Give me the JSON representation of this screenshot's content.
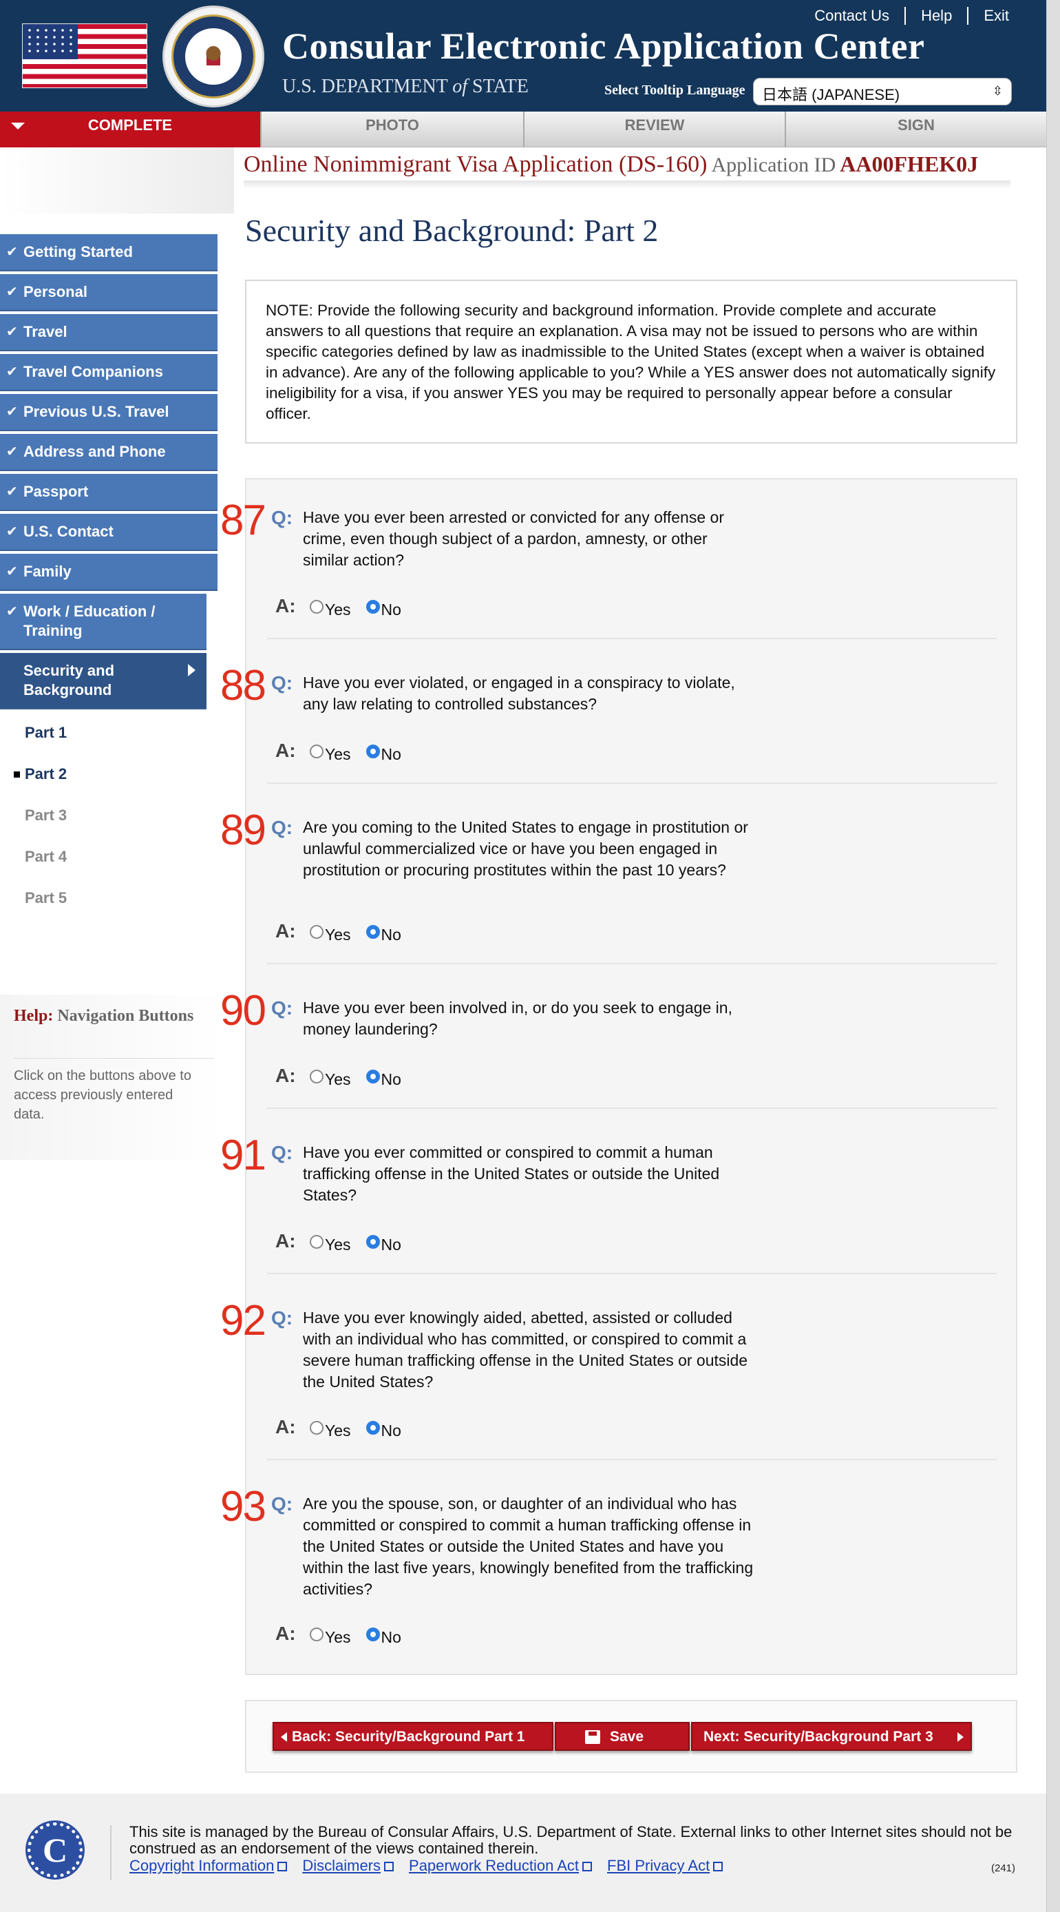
{
  "header": {
    "title": "Consular Electronic Application Center",
    "dept_prefix": "U.S. DEPARTMENT ",
    "dept_of": "of",
    "dept_suffix": " STATE",
    "links": [
      "Contact Us",
      "Help",
      "Exit"
    ],
    "tooltip_label": "Select Tooltip Language",
    "tooltip_value": "日本語 (JAPANESE)"
  },
  "progress": {
    "tabs": [
      "COMPLETE",
      "PHOTO",
      "REVIEW",
      "SIGN"
    ],
    "active": "COMPLETE"
  },
  "app": {
    "form_title": "Online Nonimmigrant Visa Application (DS-160)",
    "id_label": "Application ID",
    "id_value": "AA00FHEK0J"
  },
  "sidebar": {
    "items": [
      "Getting Started",
      "Personal",
      "Travel",
      "Travel Companions",
      "Previous U.S. Travel",
      "Address and Phone",
      "Passport",
      "U.S. Contact",
      "Family",
      "Work / Education / Training"
    ],
    "current": "Security and Background",
    "sub_items": [
      "Part 1",
      "Part 2",
      "Part 3",
      "Part 4",
      "Part 5"
    ]
  },
  "help": {
    "title_red": "Help:",
    "title_rest": " Navigation Buttons",
    "text": "Click on the buttons above to access previously entered data."
  },
  "main": {
    "page_title": "Security and Background: Part 2",
    "note": "NOTE: Provide the following security and background information. Provide complete and accurate answers to all questions that require an explanation. A visa may not be issued to persons who are within specific categories defined by law as inadmissible to the United States (except when a waiver is obtained in advance). Are any of the following applicable to you? While a YES answer does not automatically signify ineligibility for a visa, if you answer YES you may be required to personally appear before a consular officer.",
    "q_label": "Q:",
    "a_label": "A:",
    "yes_label": "Yes",
    "no_label": "No",
    "questions": [
      {
        "num": "87",
        "text": "Have you ever been arrested or convicted for any offense or crime, even though subject of a pardon, amnesty, or other similar action?",
        "answer": "No"
      },
      {
        "num": "88",
        "text": "Have you ever violated, or engaged in a conspiracy to violate, any law relating to controlled substances?",
        "answer": "No"
      },
      {
        "num": "89",
        "text": "Are you coming to the United States to engage in prostitution or unlawful commercialized vice or have you been engaged in prostitution or procuring prostitutes within the past 10 years?",
        "answer": "No"
      },
      {
        "num": "90",
        "text": "Have you ever been involved in, or do you seek to engage in, money laundering?",
        "answer": "No"
      },
      {
        "num": "91",
        "text": "Have you ever committed or conspired to commit a human trafficking offense in the United States or outside the United States?",
        "answer": "No"
      },
      {
        "num": "92",
        "text": "Have you ever knowingly aided, abetted, assisted or colluded with an individual who has committed, or conspired to commit a severe human trafficking offense in the United States or outside the United States?",
        "answer": "No"
      },
      {
        "num": "93",
        "text": "Are you the spouse, son, or daughter of an individual who has committed or conspired to commit a human trafficking offense in the United States or outside the United States and have you within the last five years, knowingly benefited from the trafficking activities?",
        "answer": "No"
      }
    ]
  },
  "actions": {
    "back": "Back: Security/Background Part 1",
    "save": "Save",
    "next": "Next: Security/Background Part 3"
  },
  "footer": {
    "logo_letter": "C",
    "text": "This site is managed by the Bureau of Consular Affairs, U.S. Department of State. External links to other Internet sites should not be construed as an endorsement of the views contained therein.",
    "links": [
      "Copyright Information",
      "Disclaimers",
      "Paperwork Reduction Act",
      "FBI Privacy Act"
    ],
    "count": "(241)"
  },
  "colors": {
    "header_bg": "#14365a",
    "nav_blue": "#4a78b6",
    "accent_red": "#c0101b",
    "question_number": "#e0301e",
    "radio_checked": "#2a7de1"
  }
}
